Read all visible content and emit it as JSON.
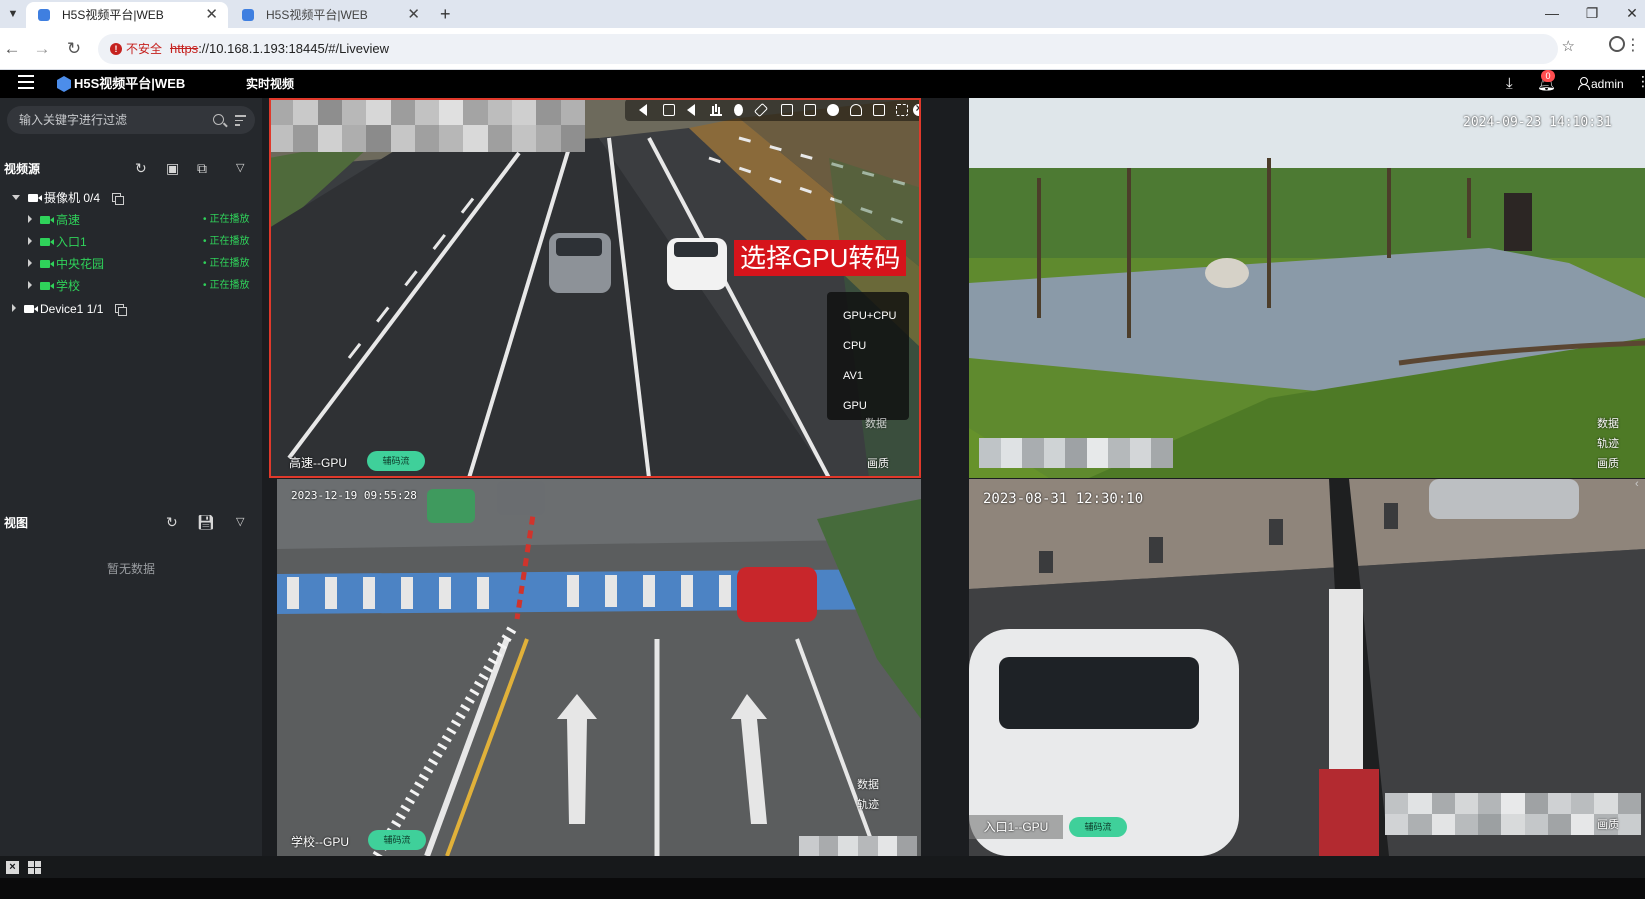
{
  "browser": {
    "tabs": [
      {
        "title": "H5S视频平台|WEB",
        "active": true
      },
      {
        "title": "H5S视频平台|WEB",
        "active": false
      }
    ],
    "security_label": "不安全",
    "url_scheme": "https",
    "url_rest": "://10.168.1.193:18445/#/Liveview"
  },
  "header": {
    "brand": "H5S视频平台|WEB",
    "page_title": "实时视频",
    "notification_count": "0",
    "user": "admin"
  },
  "sidebar": {
    "filter_placeholder": "输入关键字进行过滤",
    "video_source_title": "视频源",
    "tree": [
      {
        "label": "摄像机 0/4",
        "level": 0,
        "expanded": true
      },
      {
        "label": "高速",
        "level": 1,
        "status": "正在播放"
      },
      {
        "label": "入口1",
        "level": 1,
        "status": "正在播放"
      },
      {
        "label": "中央花园",
        "level": 1,
        "status": "正在播放"
      },
      {
        "label": "学校",
        "level": 1,
        "status": "正在播放"
      },
      {
        "label": "Device1 1/1",
        "level": 0,
        "expanded": false
      }
    ],
    "view_title": "视图",
    "view_empty": "暂无数据"
  },
  "video_cells": [
    {
      "label": "高速--GPU",
      "stream_badge": "辅码流",
      "selected": true
    },
    {
      "timestamp": "2024-09-23 14:10:31",
      "options": [
        "数据",
        "轨迹",
        "画质"
      ]
    },
    {
      "label": "学校--GPU",
      "stream_badge": "辅码流",
      "timestamp": "2023-12-19 09:55:28",
      "options": [
        "数据",
        "轨迹"
      ]
    },
    {
      "label": "入口1--GPU",
      "stream_badge": "辅码流",
      "timestamp": "2023-08-31 12:30:10",
      "options": [
        "画质"
      ]
    }
  ],
  "overlay": {
    "callout": "选择GPU转码",
    "codec_options": [
      "GPU+CPU",
      "CPU",
      "AV1",
      "GPU"
    ],
    "cell0_options": [
      "数据",
      "画质"
    ]
  },
  "colors": {
    "accent_green": "#2fd25a",
    "pill_green": "#3fd09a",
    "selected_border": "#e0392b",
    "callout_red": "#d6141b"
  }
}
